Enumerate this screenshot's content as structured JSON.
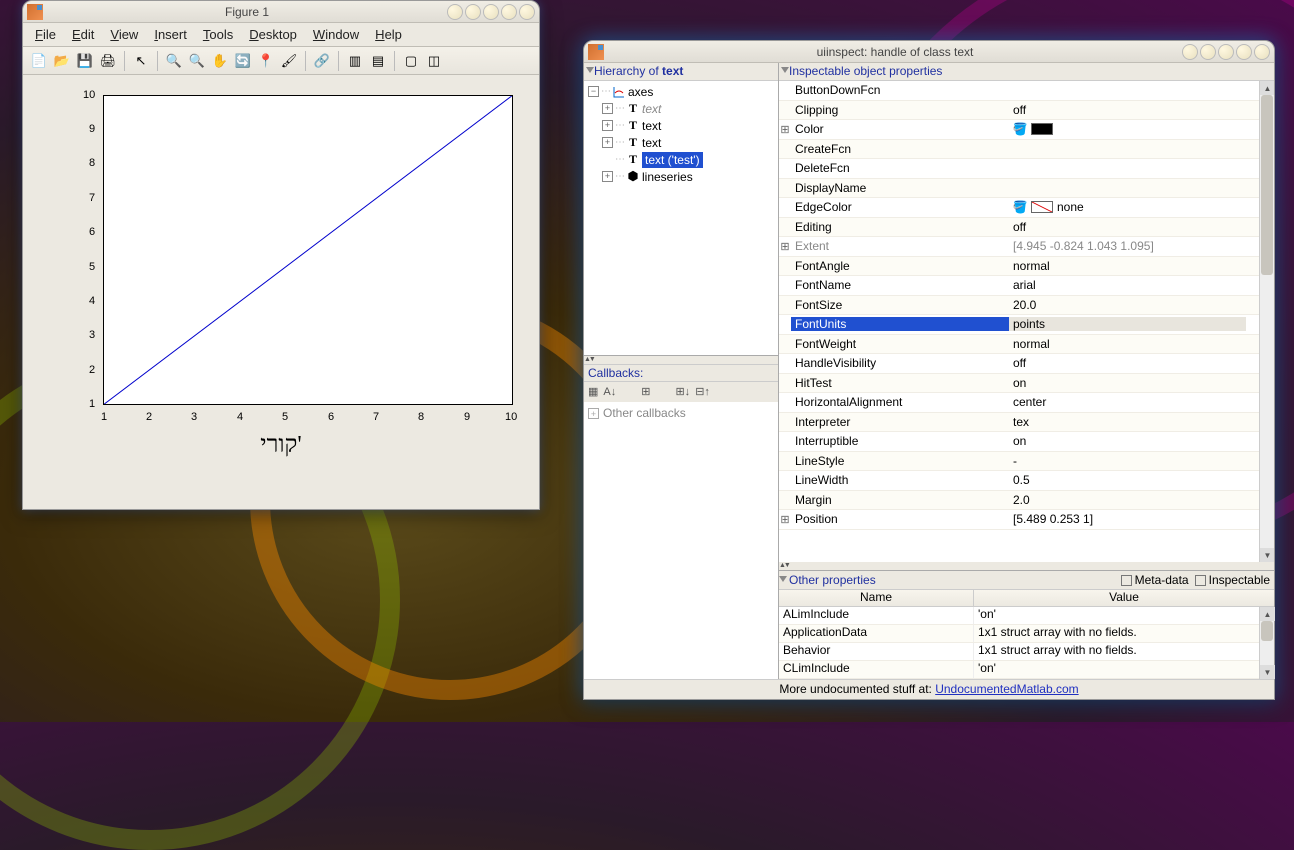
{
  "figure": {
    "title": "Figure 1",
    "menu": [
      "File",
      "Edit",
      "View",
      "Insert",
      "Tools",
      "Desktop",
      "Window",
      "Help"
    ],
    "xlabel": "קורי'"
  },
  "chart_data": {
    "type": "line",
    "x": [
      1,
      2,
      3,
      4,
      5,
      6,
      7,
      8,
      9,
      10
    ],
    "y": [
      1,
      2,
      3,
      4,
      5,
      6,
      7,
      8,
      9,
      10
    ],
    "xticks": [
      1,
      2,
      3,
      4,
      5,
      6,
      7,
      8,
      9,
      10
    ],
    "yticks": [
      1,
      2,
      3,
      4,
      5,
      6,
      7,
      8,
      9,
      10
    ],
    "xlim": [
      1,
      10
    ],
    "ylim": [
      1,
      10
    ],
    "xlabel": "קורי'"
  },
  "uiinspect": {
    "title": "uiinspect: handle of class text",
    "hierarchy_label": "Hierarchy of ",
    "hierarchy_class": "text",
    "tree": {
      "root": "axes",
      "children": [
        {
          "label": "text",
          "italic": true
        },
        {
          "label": "text"
        },
        {
          "label": "text"
        },
        {
          "label": "text ('test')",
          "selected": true
        },
        {
          "label": "lineseries"
        }
      ]
    },
    "callbacks_label": "Callbacks:",
    "other_callbacks_label": "Other callbacks",
    "props_header": "Inspectable object properties",
    "selected_prop": "FontUnits",
    "props": [
      {
        "name": "ButtonDownFcn",
        "value": "",
        "edit": true
      },
      {
        "name": "Clipping",
        "value": "off",
        "dd": true
      },
      {
        "name": "Color",
        "value": "",
        "expand": true,
        "color": "#000000"
      },
      {
        "name": "CreateFcn",
        "value": "",
        "edit": true
      },
      {
        "name": "DeleteFcn",
        "value": "",
        "edit": true
      },
      {
        "name": "DisplayName",
        "value": "",
        "edit": true
      },
      {
        "name": "EdgeColor",
        "value": "none",
        "color": "none"
      },
      {
        "name": "Editing",
        "value": "off",
        "dd": true
      },
      {
        "name": "Extent",
        "value": "[4.945 -0.824 1.043 1.095]",
        "expand": true,
        "disabled": true
      },
      {
        "name": "FontAngle",
        "value": "normal",
        "dd": true
      },
      {
        "name": "FontName",
        "value": "arial",
        "edit": true
      },
      {
        "name": "FontSize",
        "value": "20.0",
        "edit": true
      },
      {
        "name": "FontUnits",
        "value": "points",
        "dd": true,
        "selected": true
      },
      {
        "name": "FontWeight",
        "value": "normal",
        "dd": true
      },
      {
        "name": "HandleVisibility",
        "value": "off",
        "dd": true
      },
      {
        "name": "HitTest",
        "value": "on",
        "dd": true
      },
      {
        "name": "HorizontalAlignment",
        "value": "center",
        "dd": true
      },
      {
        "name": "Interpreter",
        "value": "tex",
        "dd": true
      },
      {
        "name": "Interruptible",
        "value": "on",
        "dd": true
      },
      {
        "name": "LineStyle",
        "value": "-",
        "dd": true
      },
      {
        "name": "LineWidth",
        "value": "0.5",
        "edit": true
      },
      {
        "name": "Margin",
        "value": "2.0",
        "edit": true
      },
      {
        "name": "Position",
        "value": "[5.489 0.253 1]",
        "expand": true
      }
    ],
    "other_label": "Other properties",
    "meta_chk": "Meta-data",
    "inspect_chk": "Inspectable",
    "other_cols": {
      "name": "Name",
      "value": "Value"
    },
    "other_rows": [
      {
        "name": "ALimInclude",
        "value": "'on'"
      },
      {
        "name": "ApplicationData",
        "value": "1x1 struct array with no fields."
      },
      {
        "name": "Behavior",
        "value": "1x1 struct array with no fields."
      },
      {
        "name": "CLimInclude",
        "value": "'on'"
      }
    ],
    "footer_text": "More undocumented stuff at: ",
    "footer_link": "UndocumentedMatlab.com"
  }
}
